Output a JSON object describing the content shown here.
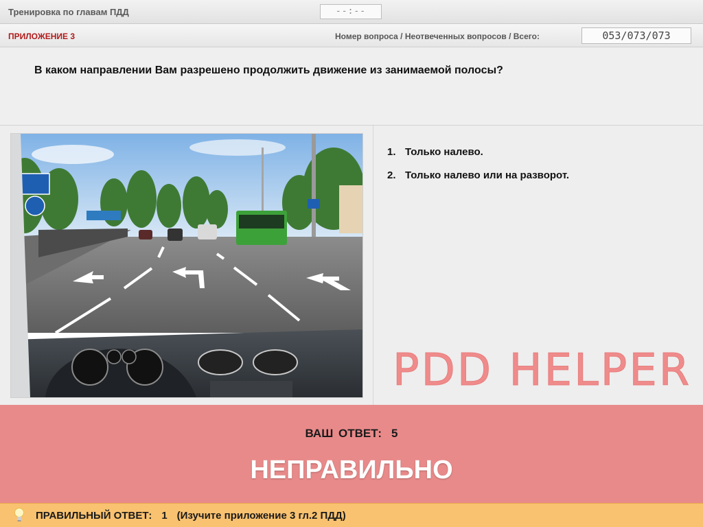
{
  "header": {
    "title": "Тренировка по главам ПДД",
    "timer": "--:--"
  },
  "subheader": {
    "appendix_label": "ПРИЛОЖЕНИЕ 3",
    "counter_label": "Номер вопроса / Неотвеченных вопросов / Всего:",
    "counter_value": "053/073/073"
  },
  "question": {
    "text": "В каком направлении Вам разрешено продолжить движение из занимаемой полосы?"
  },
  "answers": [
    {
      "num": "1.",
      "text": "Только налево."
    },
    {
      "num": "2.",
      "text": "Только налево или на разворот."
    }
  ],
  "logo": {
    "text": "PDD HELPER",
    "color": "#ef8b8b"
  },
  "result": {
    "your_answer_label": "ВАШ  ОТВЕТ:",
    "your_answer_value": "5",
    "verdict": "НЕПРАВИЛЬНО",
    "panel_color": "#e98a8a"
  },
  "footer": {
    "correct_label": "ПРАВИЛЬНЫЙ ОТВЕТ:",
    "correct_value": "1",
    "hint": "(Изучите приложение 3 гл.2 ПДД)",
    "icon": "lightbulb-icon",
    "bar_color": "#f9c270"
  }
}
